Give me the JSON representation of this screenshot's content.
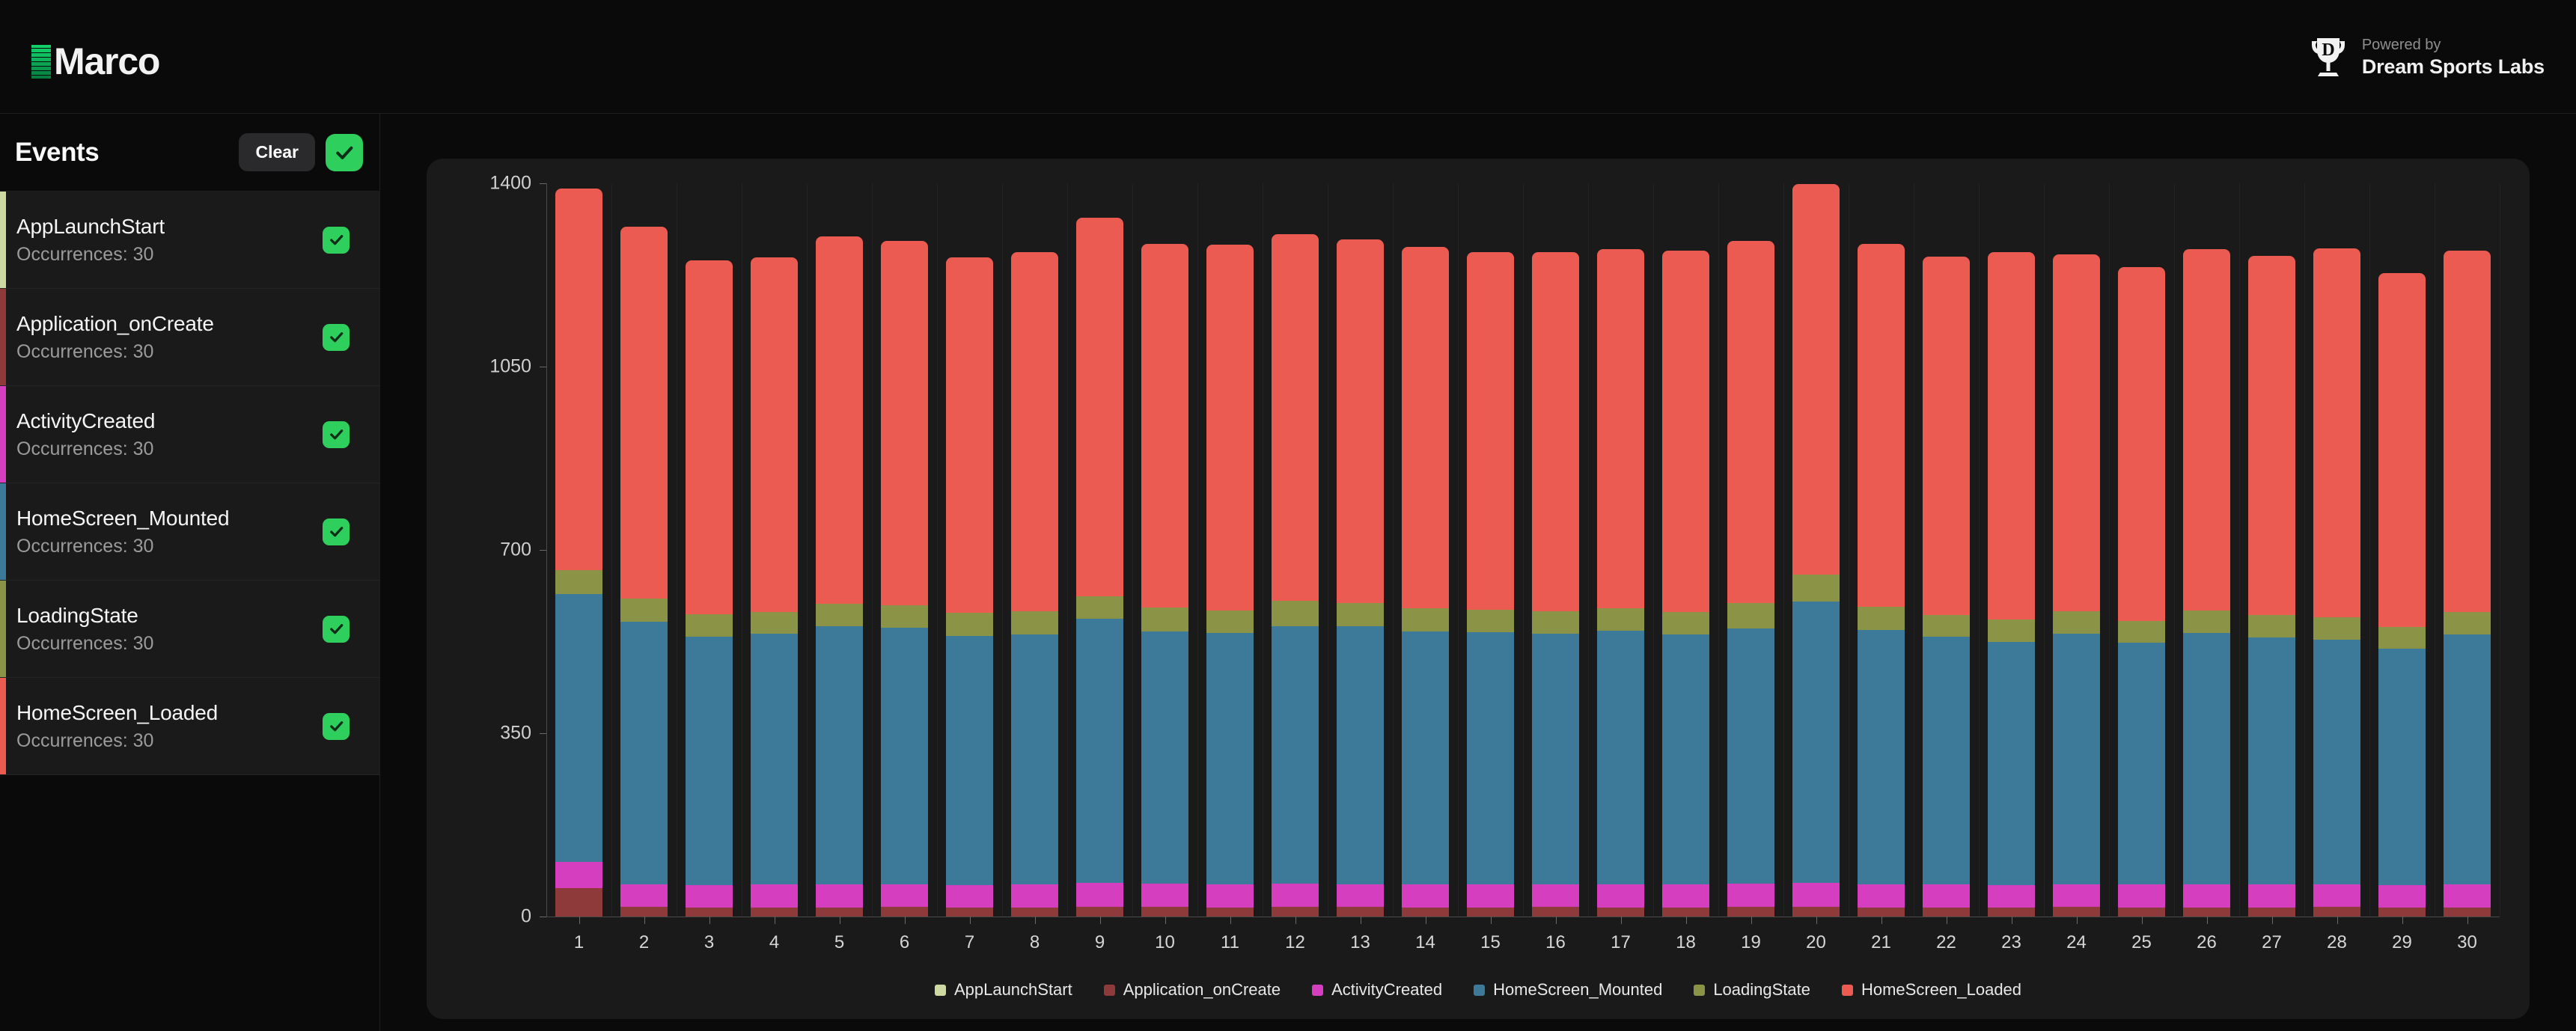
{
  "header": {
    "brand_name": "Marco",
    "brand_accent": "#10c763",
    "powered_by": "Powered by",
    "powered_name": "Dream Sports Labs",
    "trophy_letter": "D"
  },
  "sidebar": {
    "title": "Events",
    "clear_label": "Clear",
    "select_all_checked": true,
    "items": [
      {
        "name": "AppLaunchStart",
        "occurrences": "Occurrences: 30",
        "color": "#cdd9a0",
        "checked": true
      },
      {
        "name": "Application_onCreate",
        "occurrences": "Occurrences: 30",
        "color": "#8e3a3a",
        "checked": true
      },
      {
        "name": "ActivityCreated",
        "occurrences": "Occurrences: 30",
        "color": "#d63ec0",
        "checked": true
      },
      {
        "name": "HomeScreen_Mounted",
        "occurrences": "Occurrences: 30",
        "color": "#3d7999",
        "checked": true
      },
      {
        "name": "LoadingState",
        "occurrences": "Occurrences: 30",
        "color": "#8b9346",
        "checked": true
      },
      {
        "name": "HomeScreen_Loaded",
        "occurrences": "Occurrences: 30",
        "color": "#eb5b51",
        "checked": true
      }
    ]
  },
  "chart_data": {
    "type": "bar",
    "stacked": true,
    "title": "",
    "xlabel": "",
    "ylabel": "",
    "ylim": [
      0,
      1400
    ],
    "yticks": [
      0,
      350,
      700,
      1050,
      1400
    ],
    "grid": true,
    "legend_position": "bottom",
    "categories": [
      "1",
      "2",
      "3",
      "4",
      "5",
      "6",
      "7",
      "8",
      "9",
      "10",
      "11",
      "12",
      "13",
      "14",
      "15",
      "16",
      "17",
      "18",
      "19",
      "20",
      "21",
      "22",
      "23",
      "24",
      "25",
      "26",
      "27",
      "28",
      "29",
      "30"
    ],
    "series": [
      {
        "name": "AppLaunchStart",
        "color": "#cdd9a0",
        "values": [
          0,
          0,
          0,
          0,
          0,
          0,
          0,
          0,
          0,
          0,
          0,
          0,
          0,
          0,
          0,
          0,
          0,
          0,
          0,
          0,
          0,
          0,
          0,
          0,
          0,
          0,
          0,
          0,
          0,
          0
        ]
      },
      {
        "name": "Application_onCreate",
        "color": "#8e3a3a",
        "values": [
          54,
          18,
          17,
          17,
          17,
          18,
          17,
          17,
          18,
          18,
          17,
          18,
          18,
          17,
          17,
          18,
          17,
          17,
          18,
          18,
          17,
          17,
          17,
          18,
          17,
          17,
          17,
          18,
          17,
          17
        ]
      },
      {
        "name": "ActivityCreated",
        "color": "#d63ec0",
        "values": [
          50,
          44,
          43,
          44,
          44,
          44,
          43,
          44,
          46,
          45,
          44,
          45,
          44,
          45,
          44,
          44,
          45,
          44,
          45,
          47,
          44,
          44,
          43,
          44,
          44,
          44,
          44,
          44,
          43,
          44
        ]
      },
      {
        "name": "HomeScreen_Mounted",
        "color": "#3d7999",
        "values": [
          512,
          501,
          474,
          479,
          494,
          489,
          476,
          478,
          504,
          482,
          481,
          491,
          493,
          483,
          482,
          478,
          484,
          477,
          487,
          536,
          486,
          473,
          465,
          478,
          462,
          480,
          472,
          467,
          451,
          478
        ]
      },
      {
        "name": "LoadingState",
        "color": "#8b9346",
        "values": [
          46,
          44,
          43,
          42,
          42,
          43,
          44,
          44,
          44,
          45,
          43,
          49,
          44,
          43,
          43,
          43,
          43,
          44,
          48,
          52,
          44,
          42,
          42,
          43,
          42,
          43,
          43,
          42,
          42,
          43
        ]
      },
      {
        "name": "HomeScreen_Loaded",
        "color": "#eb5b51",
        "values": [
          728,
          710,
          676,
          677,
          702,
          696,
          678,
          686,
          722,
          695,
          698,
          700,
          694,
          691,
          682,
          686,
          686,
          690,
          692,
          746,
          693,
          684,
          701,
          682,
          675,
          691,
          686,
          705,
          675,
          690
        ]
      }
    ],
    "legend": [
      {
        "label": "AppLaunchStart",
        "color": "#cdd9a0"
      },
      {
        "label": "Application_onCreate",
        "color": "#8e3a3a"
      },
      {
        "label": "ActivityCreated",
        "color": "#d63ec0"
      },
      {
        "label": "HomeScreen_Mounted",
        "color": "#3d7999"
      },
      {
        "label": "LoadingState",
        "color": "#8b9346"
      },
      {
        "label": "HomeScreen_Loaded",
        "color": "#eb5b51"
      }
    ]
  }
}
